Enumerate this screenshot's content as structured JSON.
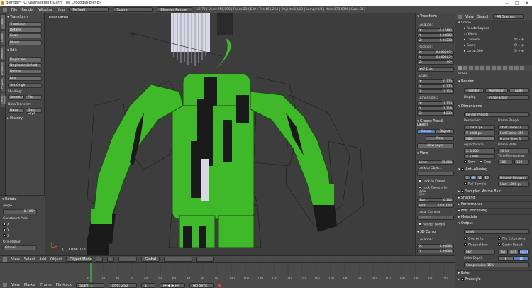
{
  "window": {
    "title": "Blender* [C:\\ulamakershit\\Garry The Crocodial.blend]"
  },
  "menubar": {
    "items": [
      "File",
      "Render",
      "Window",
      "Help"
    ],
    "layout": "Default",
    "scene": "Scene",
    "engine": "Blender Render",
    "stats": "v2.79 | Verts:255,808 | Faces:210,540 | Tris:406,264 | Objects:13/13 | Lamps:0/4 | Mem:173.93M | Cube.013"
  },
  "toolshelf": {
    "tabs": [
      "Tools",
      "Create",
      "Relations",
      "Animation",
      "Physics",
      "Grease Pencil"
    ],
    "transform_header": "Transform",
    "transform_buttons": [
      "Translate",
      "Rotate",
      "Scale",
      "Mirror"
    ],
    "edit_header": "Edit",
    "edit_buttons": [
      "Duplicate",
      "Duplicate Linked",
      "Delete",
      "Join"
    ],
    "set_origin": "Set Origin",
    "shading_label": "Shading:",
    "smooth": "Smooth",
    "flat": "Flat",
    "data_transfer_label": "Data Transfer:",
    "data": "Data",
    "data_layout": "Data Lays",
    "history_header": "History"
  },
  "redo": {
    "header": "Rotate",
    "angle_label": "Angle",
    "angle_value": "-0.765°",
    "constraint_label": "Constraint Axis",
    "axes": [
      "X",
      "Y",
      "Z"
    ],
    "orientation_label": "Orientation",
    "orientation_value": "Global"
  },
  "viewport": {
    "view_label": "User Ortho",
    "object_label": "(1) Cube.013"
  },
  "nprops": {
    "transform_header": "Transform",
    "location_label": "Location:",
    "location": [
      {
        "a": "X:",
        "v": "-6.07492"
      },
      {
        "a": "Y:",
        "v": "0.00000"
      },
      {
        "a": "Z:",
        "v": "-2.06338"
      }
    ],
    "rotation_label": "Rotation:",
    "rotation": [
      {
        "a": "X:",
        "v": "0.000009°"
      },
      {
        "a": "Y:",
        "v": "0.000003°"
      },
      {
        "a": "Z:",
        "v": "-90°"
      }
    ],
    "rotation_mode": "XYZ Euler",
    "scale_label": "Scale:",
    "scale": [
      {
        "a": "X:",
        "v": "0.770"
      },
      {
        "a": "Y:",
        "v": "0.770"
      },
      {
        "a": "Z:",
        "v": "2.113"
      }
    ],
    "dimensions_label": "Dimensions:",
    "dimensions": [
      {
        "a": "X:",
        "v": "1.723"
      },
      {
        "a": "Y:",
        "v": "1.718"
      },
      {
        "a": "Z:",
        "v": "4.239"
      }
    ],
    "grease_pencil_label": "Grease Pencil Layers",
    "scene_btn": "Scene",
    "object_btn": "Object",
    "new_btn": "New",
    "new_layer_btn": "New Layer",
    "view_header": "View",
    "lens_label": "Lens:",
    "lens_value": "35.000",
    "lock_to_object": "Lock to Object:",
    "lock_to_cursor": "Lock to Cursor",
    "lock_camera": "Lock Camera to View",
    "clip_label": "Clip:",
    "clip_start": "Start:",
    "clip_start_value": "0.100",
    "clip_end": "End:",
    "clip_end_value": "1000.000",
    "local_camera": "Local Camera:",
    "camera_value": "Camera",
    "render_border": "Render Border",
    "cursor_header": "3D Cursor",
    "cursor_location": "Location:",
    "cursor_x": "0.00000",
    "cursor_y": "0.00000"
  },
  "outliner": {
    "view": "View",
    "search": "Search",
    "filter": "All Scenes",
    "rows": [
      "Scene",
      "RenderLayers",
      "World",
      "Camera",
      "Garry",
      "Lamp.000"
    ]
  },
  "props": {
    "scene_label": "Scene",
    "render_header": "Render",
    "render_btn": "Render",
    "animation_btn": "Animation",
    "audio_btn": "Audio",
    "display_label": "Display:",
    "display_value": "Image Editor",
    "dimensions_header": "Dimensions",
    "presets": "Render Presets",
    "resolution_label": "Resolution:",
    "res_x": "X:",
    "res_x_value": "1920 px",
    "res_y": "Y:",
    "res_y_value": "1080 px",
    "res_pct": "50%",
    "frame_range_label": "Frame Range:",
    "start_frame": "Start Frame:",
    "start_frame_value": "1",
    "end_frame": "End Frame:",
    "end_frame_value": "250",
    "frame_step": "Frame Step:",
    "frame_step_value": "1",
    "aspect_label": "Aspect Ratio:",
    "aspect_x": "1.000",
    "aspect_y": "1.000",
    "frame_rate_label": "Frame Rate:",
    "frame_rate_value": "30 fps",
    "time_remap_label": "Time Remapping:",
    "remap_old": "100",
    "remap_new": "100",
    "border_label": "Bord",
    "crop_label": "Crop",
    "anti_aliasing": "Anti-Aliasing",
    "aa_samples": [
      "5",
      "8",
      "11",
      "16"
    ],
    "aa_filter": "Mitchell-Netravali",
    "full_sample": "Full Sample",
    "aa_size": "Size:",
    "aa_size_value": "1.000 px",
    "sections": [
      "Sampled Motion Blur",
      "Shading",
      "Performance",
      "Post Processing",
      "Metadata"
    ],
    "output_header": "Output",
    "output_path": "/tmp\\",
    "overwrite": "Overwrite",
    "file_extensions": "File Extensions",
    "placeholders": "Placeholders",
    "cache_result": "Cache Result",
    "format": "PNG",
    "bw": "BW",
    "rgb": "RGB",
    "rgba": "RGBA",
    "color_depth": "Color Depth:",
    "depth_8": "8",
    "depth_16": "16",
    "compression": "Compression:",
    "compression_value": "15%",
    "bake": "Bake",
    "freestyle": "Freestyle"
  },
  "vheader": {
    "items": [
      "View",
      "Select",
      "Add",
      "Object"
    ],
    "mode": "Object Mode",
    "orientation": "Global"
  },
  "timeline": {
    "ticks": [
      "0",
      "10",
      "20",
      "30",
      "40",
      "50",
      "60",
      "70",
      "80",
      "90",
      "100",
      "110",
      "120",
      "130",
      "140",
      "150",
      "160",
      "170",
      "180",
      "190",
      "200",
      "210",
      "220",
      "230",
      "240",
      "250"
    ],
    "current_frame": "1"
  },
  "tlheader": {
    "items": [
      "View",
      "Marker",
      "Frame",
      "Playback"
    ],
    "start": "Start:",
    "start_value": "1",
    "end": "End:",
    "end_value": "250",
    "current": "1",
    "sync": "No Sync"
  },
  "colors": {
    "mesh_green": "#3fb82a",
    "mesh_dark": "#1a1a1a",
    "hair_white": "#e8e8f0",
    "accent_blue": "#5680c2",
    "playhead_green": "#46c93a"
  }
}
